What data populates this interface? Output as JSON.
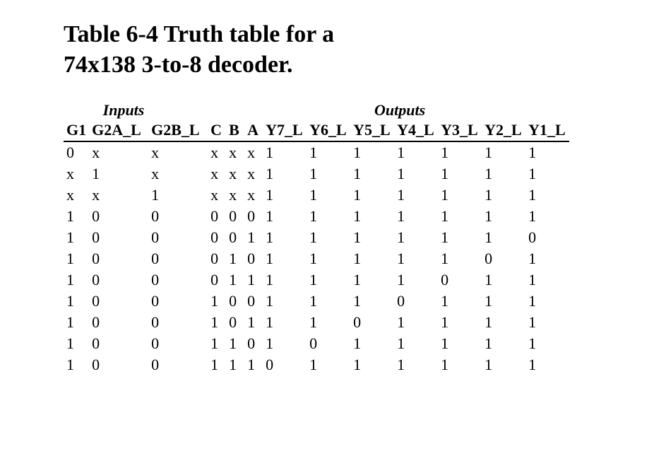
{
  "title_line1": "Table 6-4 Truth table for a",
  "title_line2": "74x138 3-to-8 decoder.",
  "group_headers": {
    "inputs": "Inputs",
    "outputs": "Outputs"
  },
  "columns": {
    "g1": "G1",
    "g2a": "G2A_L",
    "g2b": "G2B_L",
    "c": "C",
    "b": "B",
    "a": "A",
    "y7": "Y7_L",
    "y6": "Y6_L",
    "y5": "Y5_L",
    "y4": "Y4_L",
    "y3": "Y3_L",
    "y2": "Y2_L",
    "y1": "Y1_L"
  },
  "rows": [
    {
      "g1": "0",
      "g2a": "x",
      "g2b": "x",
      "c": "x",
      "b": "x",
      "a": "x",
      "y7": "1",
      "y6": "1",
      "y5": "1",
      "y4": "1",
      "y3": "1",
      "y2": "1",
      "y1": "1"
    },
    {
      "g1": "x",
      "g2a": "1",
      "g2b": "x",
      "c": "x",
      "b": "x",
      "a": "x",
      "y7": "1",
      "y6": "1",
      "y5": "1",
      "y4": "1",
      "y3": "1",
      "y2": "1",
      "y1": "1"
    },
    {
      "g1": "x",
      "g2a": "x",
      "g2b": "1",
      "c": "x",
      "b": "x",
      "a": "x",
      "y7": "1",
      "y6": "1",
      "y5": "1",
      "y4": "1",
      "y3": "1",
      "y2": "1",
      "y1": "1"
    },
    {
      "g1": "1",
      "g2a": "0",
      "g2b": "0",
      "c": "0",
      "b": "0",
      "a": "0",
      "y7": "1",
      "y6": "1",
      "y5": "1",
      "y4": "1",
      "y3": "1",
      "y2": "1",
      "y1": "1"
    },
    {
      "g1": "1",
      "g2a": "0",
      "g2b": "0",
      "c": "0",
      "b": "0",
      "a": "1",
      "y7": "1",
      "y6": "1",
      "y5": "1",
      "y4": "1",
      "y3": "1",
      "y2": "1",
      "y1": "0"
    },
    {
      "g1": "1",
      "g2a": "0",
      "g2b": "0",
      "c": "0",
      "b": "1",
      "a": "0",
      "y7": "1",
      "y6": "1",
      "y5": "1",
      "y4": "1",
      "y3": "1",
      "y2": "0",
      "y1": "1"
    },
    {
      "g1": "1",
      "g2a": "0",
      "g2b": "0",
      "c": "0",
      "b": "1",
      "a": "1",
      "y7": "1",
      "y6": "1",
      "y5": "1",
      "y4": "1",
      "y3": "0",
      "y2": "1",
      "y1": "1"
    },
    {
      "g1": "1",
      "g2a": "0",
      "g2b": "0",
      "c": "1",
      "b": "0",
      "a": "0",
      "y7": "1",
      "y6": "1",
      "y5": "1",
      "y4": "0",
      "y3": "1",
      "y2": "1",
      "y1": "1"
    },
    {
      "g1": "1",
      "g2a": "0",
      "g2b": "0",
      "c": "1",
      "b": "0",
      "a": "1",
      "y7": "1",
      "y6": "1",
      "y5": "0",
      "y4": "1",
      "y3": "1",
      "y2": "1",
      "y1": "1"
    },
    {
      "g1": "1",
      "g2a": "0",
      "g2b": "0",
      "c": "1",
      "b": "1",
      "a": "0",
      "y7": "1",
      "y6": "0",
      "y5": "1",
      "y4": "1",
      "y3": "1",
      "y2": "1",
      "y1": "1"
    },
    {
      "g1": "1",
      "g2a": "0",
      "g2b": "0",
      "c": "1",
      "b": "1",
      "a": "1",
      "y7": "0",
      "y6": "1",
      "y5": "1",
      "y4": "1",
      "y3": "1",
      "y2": "1",
      "y1": "1"
    }
  ]
}
